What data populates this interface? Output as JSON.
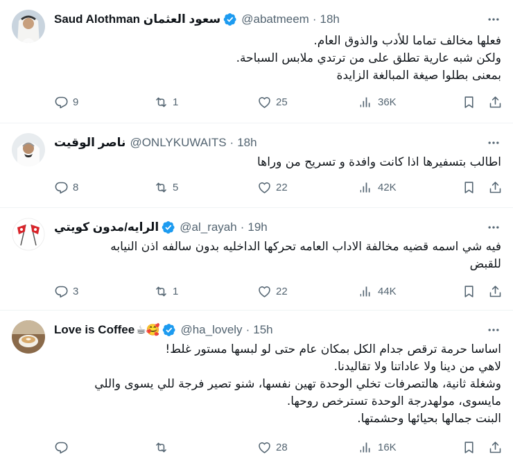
{
  "tweets": [
    {
      "name": "Saud Alothman سعود العثمان",
      "verified": true,
      "handle": "@abatmeem",
      "time": "18h",
      "lines": [
        "فعلها مخالف تماما للأدب والذوق العام.",
        "ولكن شبه عارية تطلق على من ترتدي ملابس السباحة.",
        "بمعنى بطلوا صيغة المبالغة الزايدة"
      ],
      "replies": "9",
      "retweets": "1",
      "likes": "25",
      "views": "36K"
    },
    {
      "name": "ناصر الوقيت",
      "verified": false,
      "handle": "@ONLYKUWAITS",
      "time": "18h",
      "lines": [
        "اطالب بتسفيرها اذا كانت وافدة و تسريح من وراها"
      ],
      "replies": "8",
      "retweets": "5",
      "likes": "22",
      "views": "42K"
    },
    {
      "name": "الرايه/مدون كويتي",
      "verified": true,
      "handle": "@al_rayah",
      "time": "19h",
      "lines": [
        "فيه شي اسمه قضيه مخالفة الاداب العامه تحركها الداخليه بدون سالفه اذن النيابه",
        "للقبض"
      ],
      "replies": "3",
      "retweets": "1",
      "likes": "22",
      "views": "44K"
    },
    {
      "name": "Love is Coffee",
      "name_emoji": "☕🥰",
      "verified": true,
      "handle": "@ha_lovely",
      "time": "15h",
      "lines": [
        "اساسا حرمة ترقص جدام الكل بمكان عام حتى لو لبسها مستور غلط!",
        "لاهي من دينا ولا عاداتنا ولا تقاليدنا.",
        "وشغلة ثانية، هالتصرفات تخلي الوحدة تهين نفسها، شنو تصير فرجة للي يسوى واللي",
        "مايسوى، مولهدرجة الوحدة تسترخص روحها.",
        "البنت جمالها بحيائها وحشمتها."
      ],
      "replies": "",
      "retweets": "",
      "likes": "28",
      "views": "16K"
    }
  ],
  "colors": {
    "muted": "#536471",
    "verified": "#1d9bf0",
    "text": "#0f1419",
    "divider": "#eff3f4"
  },
  "icons": [
    "reply-icon",
    "retweet-icon",
    "like-icon",
    "views-icon",
    "bookmark-icon",
    "share-icon",
    "more-icon",
    "verified-badge-icon"
  ]
}
